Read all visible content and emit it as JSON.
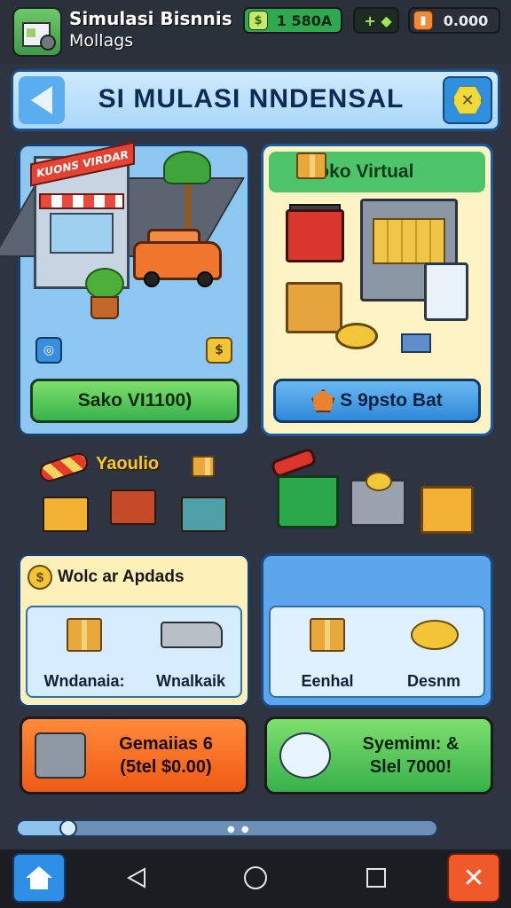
{
  "app": {
    "title": "Simulasi Bisnnis",
    "subtitle": "Mollags"
  },
  "currency": {
    "money": "1 580A",
    "gems_icon": "+ ◆",
    "coins": "0.000"
  },
  "header": {
    "title": "SI MULASI NNDENSAL"
  },
  "cards": {
    "left": {
      "store_sign": "KUONS VIRDAR",
      "button_label": "Sako VI1100)"
    },
    "right": {
      "title": "Toko Virtual",
      "button_label": "S 9psto Bat"
    }
  },
  "decor": {
    "label": "Yaoulio"
  },
  "upgrades": {
    "title": "Wolc ar Apdads",
    "left_items": [
      {
        "label": "Wndanaia:",
        "icon": "box-icon"
      },
      {
        "label": "Wnalkaik",
        "icon": "van-icon"
      }
    ],
    "right_items": [
      {
        "label": "Eenhal",
        "icon": "box-icon"
      },
      {
        "label": "Desnm",
        "icon": "coins-icon"
      }
    ]
  },
  "actions": {
    "orange": {
      "line1": "Gemaiias 6",
      "line2": "(5tel $0.00)"
    },
    "green": {
      "line1": "Syemimı: &",
      "line2": "Slel 7000!"
    }
  },
  "progress": {
    "value_fraction": 0.12
  },
  "colors": {
    "accent_blue": "#2f8fdc",
    "accent_green": "#38b24a",
    "accent_orange": "#f05a14",
    "gold": "#f3c435"
  }
}
